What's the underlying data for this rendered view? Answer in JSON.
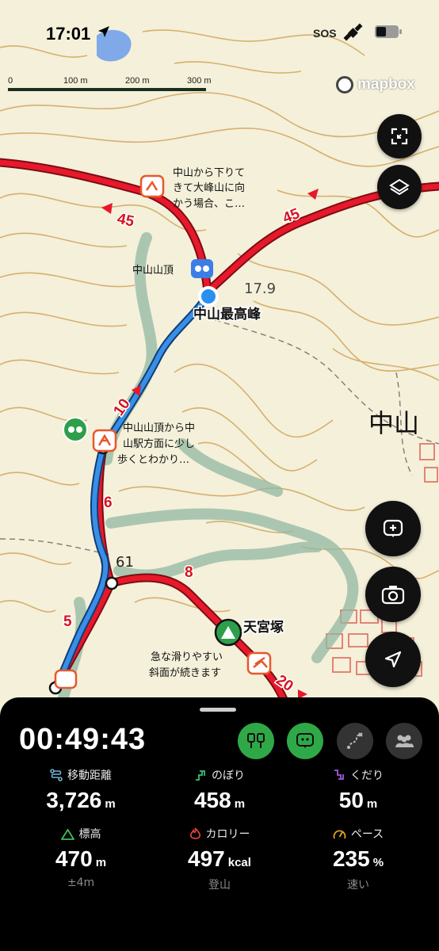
{
  "status": {
    "time": "17:01",
    "sos": "SOS"
  },
  "scale": {
    "labels": [
      "0",
      "100 m",
      "200 m",
      "300 m"
    ]
  },
  "attribution": "mapbox",
  "map": {
    "labels": {
      "nakayama_summit": "中山山頂",
      "highest_peak": "中山最高峰",
      "elevation": "17.9",
      "area_name": "中山",
      "spot_61": "61",
      "tenguzuka": "天宮塚"
    },
    "route_markers": [
      "45",
      "45",
      "10",
      "6",
      "8",
      "5",
      "20"
    ],
    "notes": [
      [
        "中山から下りて",
        "きて大峰山に向",
        "かう場合、こ…"
      ],
      [
        "中山山頂から中",
        "山駅方面に少し",
        "歩くとわかり…"
      ],
      [
        "急な滑りやすい",
        "斜面が続きます"
      ]
    ]
  },
  "controls": {
    "icons": [
      "fit-route-icon",
      "layers-icon",
      "add-note-icon",
      "camera-icon",
      "navigate-arrow-icon"
    ]
  },
  "activity": {
    "elapsed": "00:49:43",
    "stats": [
      {
        "label": "移動距離",
        "value": "3,726",
        "unit": "m",
        "icon": "distance-icon",
        "color": "#6fb4d6"
      },
      {
        "label": "のぼり",
        "value": "458",
        "unit": "m",
        "icon": "ascent-icon",
        "color": "#36c07a"
      },
      {
        "label": "くだり",
        "value": "50",
        "unit": "m",
        "icon": "descent-icon",
        "color": "#a25ad9"
      },
      {
        "label": "標高",
        "value": "470",
        "unit": "m",
        "sub": "±4m",
        "icon": "elevation-icon",
        "color": "#3fbf5a"
      },
      {
        "label": "カロリー",
        "value": "497",
        "unit": "kcal",
        "sub": "登山",
        "icon": "calorie-icon",
        "color": "#e8433a"
      },
      {
        "label": "ペース",
        "value": "235",
        "unit": "%",
        "sub": "速い",
        "icon": "pace-icon",
        "color": "#e5a21f"
      }
    ]
  },
  "colors": {
    "route_red": "#e8182b",
    "track_blue": "#2f7fd6",
    "contour": "#cfa55b",
    "accent_green": "#3cbc3a"
  }
}
